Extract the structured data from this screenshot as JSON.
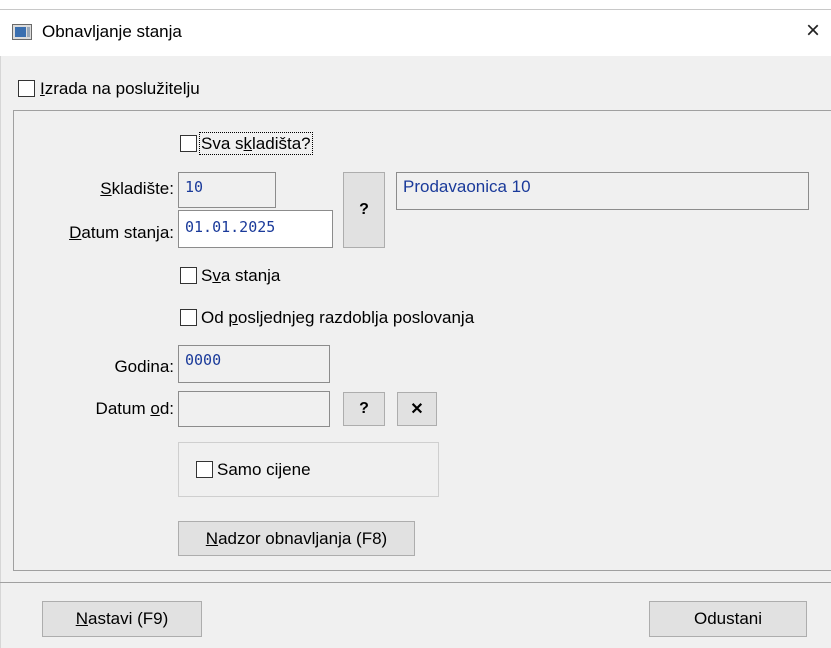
{
  "window": {
    "title": "Obnavljanje stanja",
    "close_label": "×"
  },
  "server_build": {
    "label_first": "I",
    "label_rest": "zrada na poslužitelju",
    "checked": false
  },
  "all_warehouses": {
    "label_a": "Sva s",
    "label_u": "k",
    "label_b": "ladišta?",
    "checked": false
  },
  "warehouse": {
    "label_u": "S",
    "label_rest": "kladište:",
    "value": "10",
    "name": "Prodavaonica 10"
  },
  "state_date": {
    "label_u": "D",
    "label_rest": "atum stanja:",
    "value": "01.01.2025"
  },
  "lookup_button": {
    "label": "?"
  },
  "all_states": {
    "label_a": "S",
    "label_u": "v",
    "label_b": "a stanja",
    "checked": false
  },
  "from_last_period": {
    "label_a": "Od ",
    "label_u": "p",
    "label_b": "osljednjeg razdoblja poslovanja",
    "checked": false
  },
  "year": {
    "label": "Godina:",
    "value": "0000"
  },
  "date_from": {
    "label_a": "Datum ",
    "label_u": "o",
    "label_b": "d:",
    "value": "",
    "lookup_label": "?",
    "clear_label": "✕"
  },
  "prices_only": {
    "label": "Samo cijene",
    "checked": false
  },
  "monitor_button": {
    "label_u": "N",
    "label_rest": "adzor obnavljanja (F8)"
  },
  "continue_button": {
    "label_u": "N",
    "label_rest": "astavi (F9)"
  },
  "cancel_button": {
    "label": "Odustani"
  }
}
